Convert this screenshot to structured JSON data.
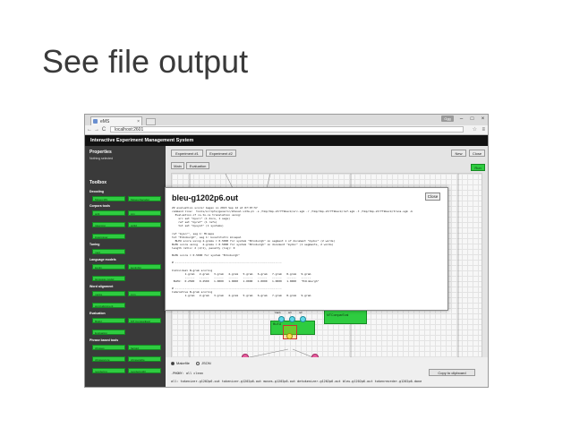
{
  "slide": {
    "title": "See file output"
  },
  "browser": {
    "tab_title": "eMS",
    "tab_close": "×",
    "url": "localhost:2601",
    "user_chip": "Ggg",
    "win_min": "–",
    "win_max": "□",
    "win_close": "×",
    "back": "←",
    "forward": "→",
    "reload": "C",
    "star": "☆",
    "menu": "≡"
  },
  "app": {
    "title": "Interactive Experiment Management System",
    "properties_heading": "Properties",
    "properties_sub": "Nothing selected",
    "toolbox_heading": "Toolbox",
    "sections": [
      {
        "label": "Decoding",
        "tools": [
          "Moses MS",
          "Moses Decoder"
        ]
      },
      {
        "label": "Corpora tools",
        "tools": [
          "split",
          "join",
          "tokenizer",
          "split2",
          "lowercaser"
        ]
      },
      {
        "label": "Tuning",
        "tools": [
          "mert"
        ]
      },
      {
        "label": "Language models",
        "tools": [
          "kenlm",
          "kenlmbin",
          "language model"
        ]
      },
      {
        "label": "Word alignment",
        "tools": [
          "mgiza",
          "sym",
          "word alignment"
        ]
      },
      {
        "label": "Evaluation",
        "tools": [
          "BLEU",
          "MT ComparEval",
          "Evaluation"
        ]
      },
      {
        "label": "Phrase based tools",
        "tools": [
          "phrases",
          "factoid",
          "phrasescore",
          "phrasetable",
          "reordering",
          "reorderingtbl"
        ]
      }
    ],
    "experiment_tabs": [
      "Experiment #1",
      "Experiment #2"
    ],
    "new_label": "New",
    "close_label": "Close",
    "view_tabs": [
      "Main",
      "Evaluation"
    ],
    "run_label": "Run",
    "nodes": {
      "bleu": "BLEU",
      "comparator": "MTComparEval",
      "ports": [
        "trans",
        "src",
        "ref"
      ]
    },
    "footer": {
      "radio_makefile": "Makefile",
      "radio_json": "JSON",
      "line1": ".PHONY: all clean",
      "line2": "all: tokenizer-g1202p6.out tokenizer-g1202p6.out moses-g1202p6.out detokenizer-g1202p6.out bleu-g1202p6.out tokenreorder-g1202p6.done",
      "copy_label": "Copy to clipboard"
    }
  },
  "modal": {
    "title": "bleu-g1202p6.out",
    "close_label": "Close",
    "lines": [
      "ZZ evaluation scorer began on 2015 Sep 12 at 07:07:57",
      "command line:  tools/scripts/generic/mteval-v13a.pl -s /tmp/tmp.aYrYfkbeck/src.sgm -r /tmp/tmp.aYrYfkbeck/ref.sgm -t /tmp/tmp.aYrYfkbeck/trans.sgm -b",
      "  Evaluation of cs-to-cs translation using:",
      "    src set \"mysrc\" (1 docs, 1 segs)",
      "    ref set \"myref\" (1 refs)",
      "    tst set \"mysyst\" (1 systems)",
      "",
      "ref \"myscr\", seg 1: Minepa",
      "tst \"Edinburgh\", seg 1: konstitutli minepal",
      "  BLEU score using 4-grams = 0.5000 for system \"Edinburgh\" on segment 1 of document \"mydoc\" (2 words)",
      "BLEU score using   4-grams = 0.5000 for system \"Edinburgh\" on document \"mydoc\" (1 segments, 2 words)",
      "length ratio: 2 (2/1), penalty (log): 0",
      "",
      "BLEU score = 0.5000 for system \"Edinburgh\"",
      "",
      "# ------------------------------------------------------------------",
      "",
      "Individual N-gram scoring",
      "        1-gram   2-gram   3-gram   4-gram   5-gram   6-gram   7-gram   8-gram   9-gram",
      "        ------   ------   ------   ------   ------   ------   ------   ------   ------",
      " BLEU:  0.2500   0.2500   1.0000   1.0000   1.0000   1.0000   1.0000   1.0000   \"Edinburgh\"",
      "",
      "# ------------------------------------------------------------------",
      "Cumulative N-gram scoring",
      "        1-gram   2-gram   3-gram   4-gram   5-gram   6-gram   7-gram   8-gram   9-gram"
    ]
  }
}
